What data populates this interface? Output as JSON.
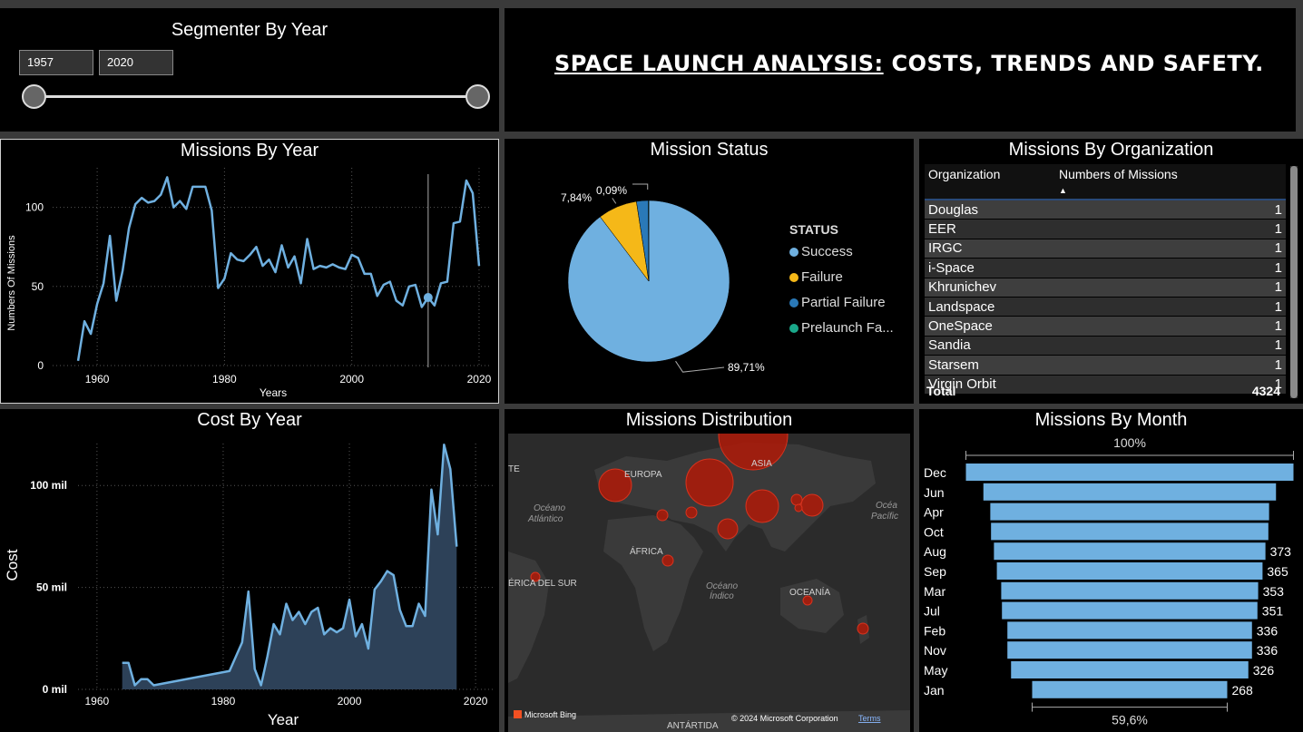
{
  "segmenter": {
    "title": "Segmenter By Year",
    "from": "1957",
    "to": "2020"
  },
  "header": {
    "title_underlined": "SPACE LAUNCH ANALYSIS:",
    "title_rest": " COSTS, TRENDS AND SAFETY."
  },
  "missions_by_year": {
    "title": "Missions By Year",
    "chart_data": {
      "type": "line",
      "xlabel": "Years",
      "ylabel": "Numbers Of Missions",
      "xlim": [
        1953,
        2022
      ],
      "ylim": [
        0,
        125
      ],
      "xticks": [
        "1960",
        "1980",
        "2000",
        "2020"
      ],
      "yticks": [
        "0",
        "50",
        "100"
      ],
      "highlight_year": 2012,
      "x": [
        1957,
        1958,
        1959,
        1960,
        1961,
        1962,
        1963,
        1964,
        1965,
        1966,
        1967,
        1968,
        1969,
        1970,
        1971,
        1972,
        1973,
        1974,
        1975,
        1976,
        1977,
        1978,
        1979,
        1980,
        1981,
        1982,
        1983,
        1984,
        1985,
        1986,
        1987,
        1988,
        1989,
        1990,
        1991,
        1992,
        1993,
        1994,
        1995,
        1996,
        1997,
        1998,
        1999,
        2000,
        2001,
        2002,
        2003,
        2004,
        2005,
        2006,
        2007,
        2008,
        2009,
        2010,
        2011,
        2012,
        2013,
        2014,
        2015,
        2016,
        2017,
        2018,
        2019,
        2020
      ],
      "values": [
        3,
        28,
        20,
        39,
        52,
        82,
        41,
        60,
        87,
        102,
        106,
        103,
        104,
        108,
        119,
        100,
        104,
        99,
        113,
        113,
        113,
        98,
        49,
        55,
        71,
        67,
        66,
        70,
        75,
        63,
        67,
        59,
        76,
        62,
        69,
        52,
        80,
        61,
        63,
        62,
        64,
        62,
        61,
        70,
        68,
        58,
        58,
        44,
        51,
        53,
        41,
        38,
        50,
        51,
        37,
        43,
        38,
        52,
        53,
        90,
        91,
        117,
        109,
        63
      ]
    }
  },
  "mission_status": {
    "title": "Mission Status",
    "legend_title": "STATUS",
    "chart_data": {
      "type": "pie",
      "labels": [
        "Success",
        "Failure",
        "Partial Failure",
        "Prelaunch Fa..."
      ],
      "values": [
        89.71,
        7.84,
        2.36,
        0.09
      ],
      "data_labels": [
        "89,71%",
        "7,84%",
        "",
        "0,09%"
      ],
      "colors": [
        "#6fb0e0",
        "#f5b818",
        "#2a79b8",
        "#1aa88a"
      ]
    }
  },
  "missions_by_org": {
    "title": "Missions By Organization",
    "col1": "Organization",
    "col2": "Numbers of Missions",
    "rows": [
      {
        "org": "Douglas",
        "n": "1"
      },
      {
        "org": "EER",
        "n": "1"
      },
      {
        "org": "IRGC",
        "n": "1"
      },
      {
        "org": "i-Space",
        "n": "1"
      },
      {
        "org": "Khrunichev",
        "n": "1"
      },
      {
        "org": "Landspace",
        "n": "1"
      },
      {
        "org": "OneSpace",
        "n": "1"
      },
      {
        "org": "Sandia",
        "n": "1"
      },
      {
        "org": "Starsem",
        "n": "1"
      },
      {
        "org": "Virgin Orbit",
        "n": "1"
      }
    ],
    "total_label": "Total",
    "total_value": "4324"
  },
  "cost_by_year": {
    "title": "Cost By Year",
    "chart_data": {
      "type": "area",
      "xlabel": "Year",
      "ylabel": "Cost",
      "xlim": [
        1957,
        2023
      ],
      "ylim": [
        0,
        125
      ],
      "xticks": [
        "1960",
        "1980",
        "2000",
        "2020"
      ],
      "yticks": [
        "0 mil",
        "50 mil",
        "100 mil"
      ],
      "x": [
        1964,
        1965,
        1966,
        1967,
        1968,
        1969,
        1981,
        1983,
        1984,
        1985,
        1986,
        1987,
        1988,
        1989,
        1990,
        1991,
        1992,
        1993,
        1994,
        1995,
        1996,
        1997,
        1998,
        1999,
        2000,
        2001,
        2002,
        2003,
        2004,
        2005,
        2006,
        2007,
        2008,
        2009,
        2010,
        2011,
        2012,
        2013,
        2014,
        2015,
        2016,
        2017,
        2018,
        2019,
        2020
      ],
      "values": [
        13,
        13,
        2,
        5,
        5,
        2,
        9,
        23,
        48,
        10,
        2,
        16,
        32,
        27,
        42,
        34,
        38,
        32,
        38,
        40,
        27,
        30,
        28,
        30,
        44,
        26,
        32,
        20,
        49,
        53,
        58,
        56,
        39,
        31,
        31,
        42,
        36,
        98,
        76,
        120,
        108,
        70,
        0,
        0,
        0
      ]
    }
  },
  "missions_distribution": {
    "title": "Missions Distribution",
    "map_labels": {
      "europa": "EUROPA",
      "asia": "ASIA",
      "africa": "ÁFRICA",
      "oceania": "OCEANÍA",
      "sur": "ÉRICA DEL SUR",
      "antartida": "ANTÁRTIDA",
      "te": "TE",
      "atlantico1": "Océano",
      "atlantico2": "Atlántico",
      "indico1": "Océano",
      "indico2": "Índico",
      "pacifico1": "Océa",
      "pacifico2": "Pacífic"
    },
    "brand": "Microsoft Bing",
    "copyright": "© 2024 Microsoft Corporation",
    "terms": "Terms"
  },
  "missions_by_month": {
    "title": "Missions By Month",
    "top_pct": "100%",
    "bottom_pct": "59,6%",
    "chart_data": {
      "type": "bar",
      "categories": [
        "Dec",
        "Jun",
        "Apr",
        "Oct",
        "Aug",
        "Sep",
        "Mar",
        "Jul",
        "Feb",
        "Nov",
        "May",
        "Jan"
      ],
      "values": [
        450,
        402,
        383,
        381,
        373,
        365,
        353,
        351,
        336,
        336,
        326,
        268
      ],
      "data_labels": [
        "",
        "",
        "",
        "",
        "373",
        "365",
        "353",
        "351",
        "336",
        "336",
        "326",
        "268"
      ]
    }
  }
}
